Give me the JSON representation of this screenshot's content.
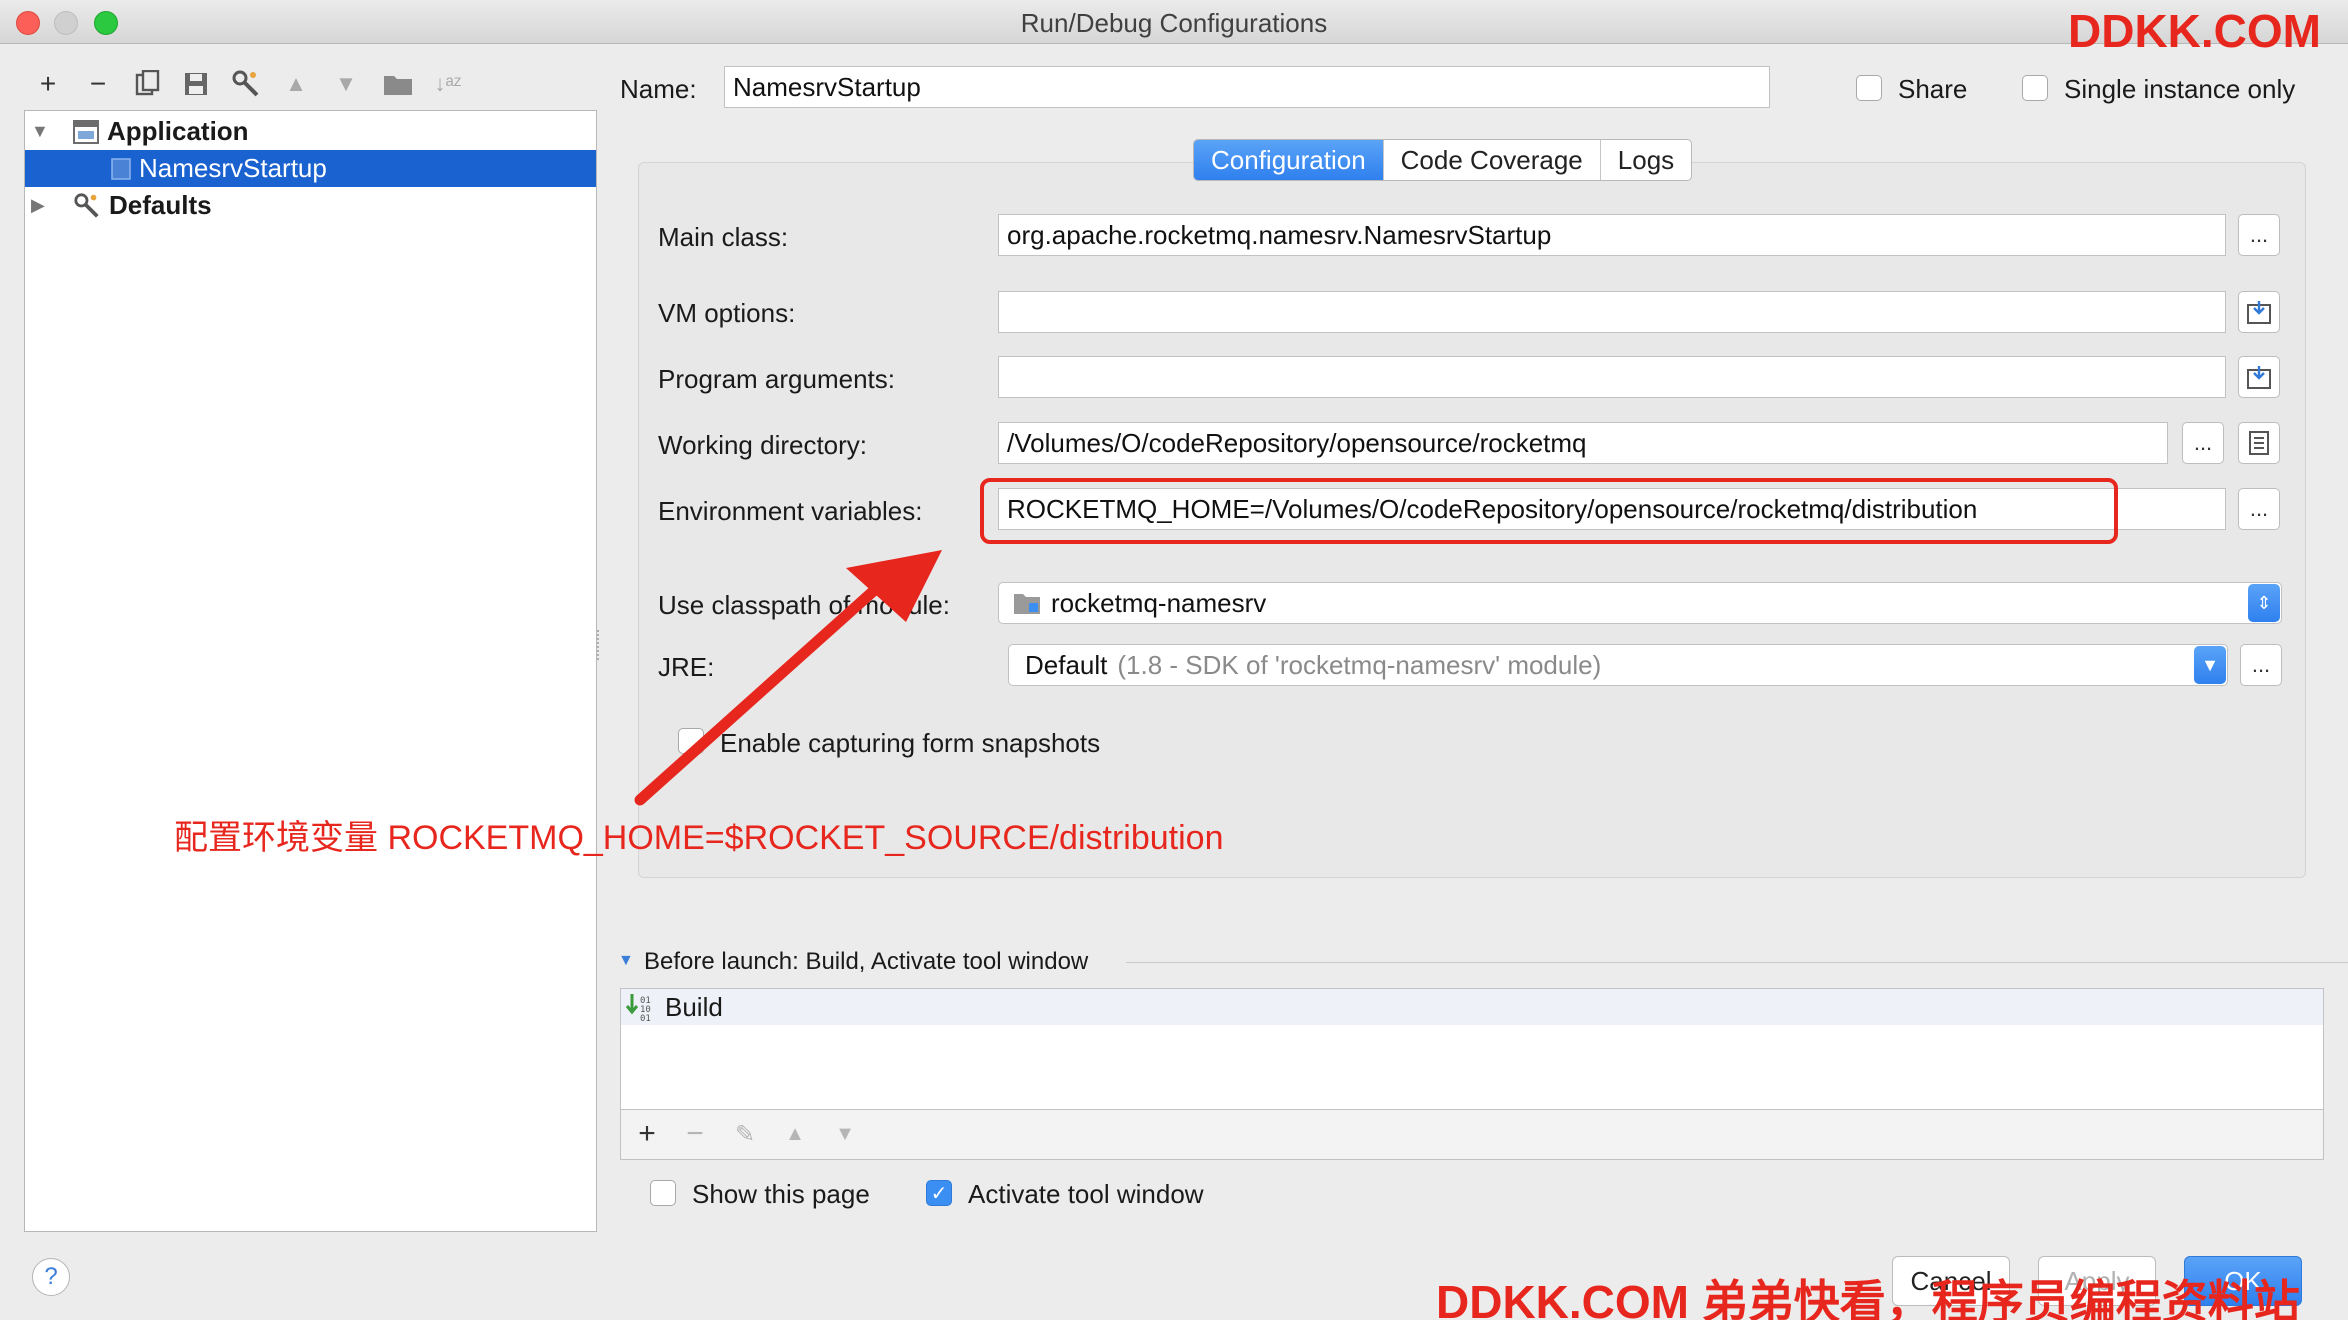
{
  "window": {
    "title": "Run/Debug Configurations"
  },
  "toolbar": {
    "icons": [
      "plus-icon",
      "minus-icon",
      "copy-icon",
      "save-icon",
      "wrench-icon",
      "arrow-up-icon",
      "arrow-down-icon",
      "folder-icon",
      "sort-az-icon"
    ]
  },
  "tree": {
    "items": [
      {
        "label": "Application"
      },
      {
        "label": "NamesrvStartup"
      },
      {
        "label": "Defaults"
      }
    ]
  },
  "header": {
    "name_label": "Name:",
    "name_value": "NamesrvStartup",
    "share_label": "Share",
    "single_label": "Single instance only"
  },
  "tabs": [
    {
      "label": "Configuration"
    },
    {
      "label": "Code Coverage"
    },
    {
      "label": "Logs"
    }
  ],
  "form": {
    "main_class_label": "Main class:",
    "main_class_value": "org.apache.rocketmq.namesrv.NamesrvStartup",
    "vm_label": "VM options:",
    "vm_value": "",
    "args_label": "Program arguments:",
    "args_value": "",
    "wd_label": "Working directory:",
    "wd_value": "/Volumes/O/codeRepository/opensource/rocketmq",
    "env_label": "Environment variables:",
    "env_value": "ROCKETMQ_HOME=/Volumes/O/codeRepository/opensource/rocketmq/distribution",
    "classpath_label": "Use classpath of module:",
    "classpath_value": "rocketmq-namesrv",
    "jre_label": "JRE:",
    "jre_value": "Default",
    "jre_detail": "(1.8 - SDK of 'rocketmq-namesrv' module)",
    "snapshots_label": "Enable capturing form snapshots",
    "ellipsis": "..."
  },
  "annotation": {
    "text": "配置环境变量 ROCKETMQ_HOME=$ROCKET_SOURCE/distribution",
    "color": "#e7261d"
  },
  "before_launch": {
    "title": "Before launch: Build, Activate tool window",
    "items": [
      {
        "label": "Build"
      }
    ]
  },
  "options": {
    "show_page_label": "Show this page",
    "activate_label": "Activate tool window"
  },
  "buttons": {
    "help": "?",
    "cancel": "Cancel",
    "apply": "Apply",
    "ok": "OK"
  },
  "watermark": {
    "top": "DDKK.COM",
    "bottom": "DDKK.COM 弟弟快看，程序员编程资料站"
  }
}
